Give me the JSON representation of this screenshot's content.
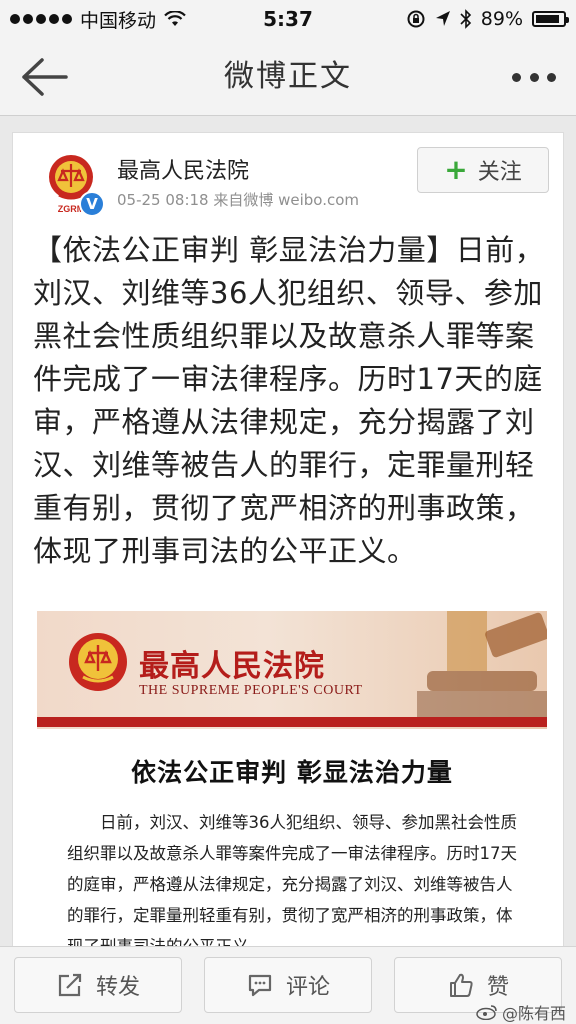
{
  "status_bar": {
    "carrier": "中国移动",
    "time": "5:37",
    "battery": "89%",
    "battery_level": 0.89
  },
  "nav": {
    "title": "微博正文"
  },
  "post": {
    "author": "最高人民法院",
    "avatar_text": "ZGRM",
    "verified_badge": "V",
    "meta": "05-25 08:18  来自微博 weibo.com",
    "follow_label": "关注",
    "text": "【依法公正审判 彰显法治力量】日前，刘汉、刘维等36人犯组织、领导、参加黑社会性质组织罪以及故意杀人罪等案件完成了一审法律程序。历时17天的庭审，严格遵从法律规定，充分揭露了刘汉、刘维等被告人的罪行，定罪量刑轻重有别，贯彻了宽严相济的刑事政策，体现了刑事司法的公平正义。"
  },
  "embedded_image": {
    "banner_cn": "最高人民法院",
    "banner_en": "THE SUPREME PEOPLE'S COURT",
    "title": "依法公正审判  彰显法治力量",
    "body": "日前，刘汉、刘维等36人犯组织、领导、参加黑社会性质组织罪以及故意杀人罪等案件完成了一审法律程序。历时17天的庭审，严格遵从法律规定，充分揭露了刘汉、刘维等被告人的罪行，定罪量刑轻重有别，贯彻了宽严相济的刑事政策，体现了刑事司法的公平正义。",
    "colors": {
      "red": "#b41d1a",
      "banner_bg": "#f1d9c9"
    }
  },
  "toolbar": {
    "repost_label": "转发",
    "comment_label": "评论",
    "like_label": "赞"
  },
  "watermark": "@陈有西",
  "colors": {
    "accent_green": "#3aa83a",
    "verified_blue": "#2a7fd8"
  }
}
